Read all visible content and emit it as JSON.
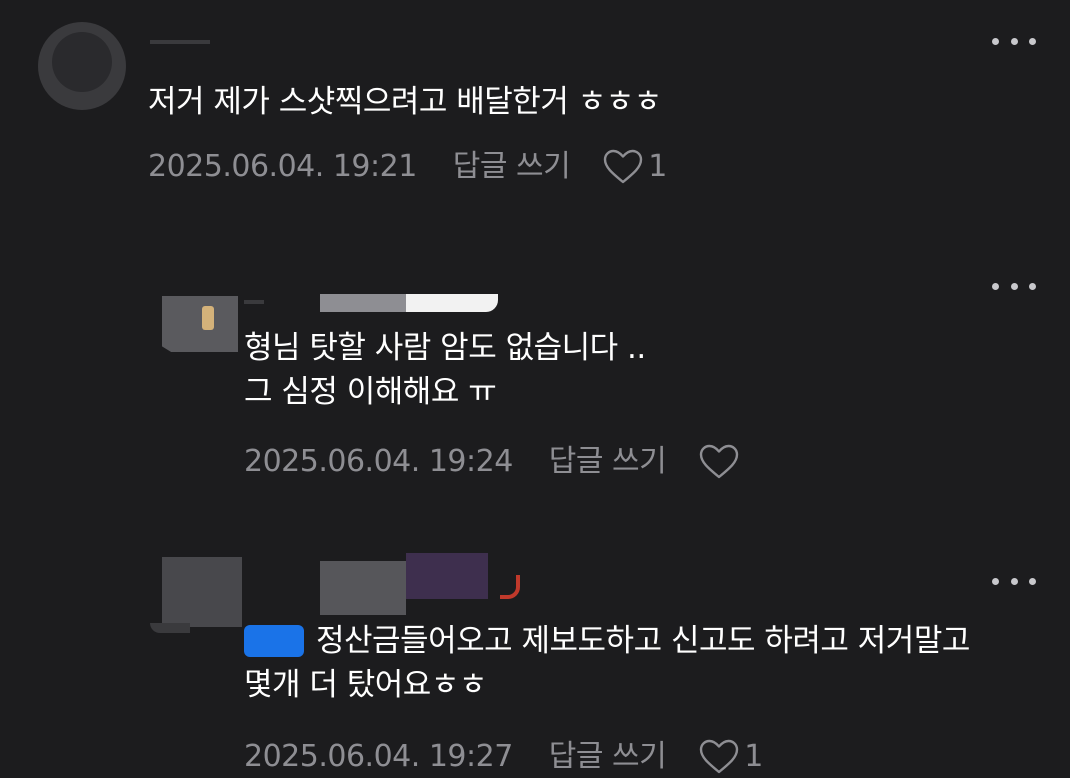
{
  "comments": [
    {
      "text_lines": [
        "저거 제가 스샷찍으려고 배달한거 ㅎㅎㅎ"
      ],
      "date": "2025.06.04. 19:21",
      "reply_label": "답글 쓰기",
      "likes": "1"
    },
    {
      "text_lines": [
        "형님 탓할 사람 암도 없습니다 ..",
        "그 심정 이해해요 ㅠ"
      ],
      "date": "2025.06.04. 19:24",
      "reply_label": "답글 쓰기",
      "likes": ""
    },
    {
      "text_lines": [
        "정산금들어오고 제보도하고 신고도 하려고 저거말고",
        "몇개 더 탔어요ㅎㅎ"
      ],
      "date": "2025.06.04. 19:27",
      "reply_label": "답글 쓰기",
      "likes": "1"
    }
  ],
  "icons": {
    "more": "more-dots-icon",
    "like": "heart-outline-icon"
  },
  "colors": {
    "background": "#1c1c1e",
    "text": "#ffffff",
    "meta": "#8e8e93",
    "mention": "#1a73e8"
  }
}
